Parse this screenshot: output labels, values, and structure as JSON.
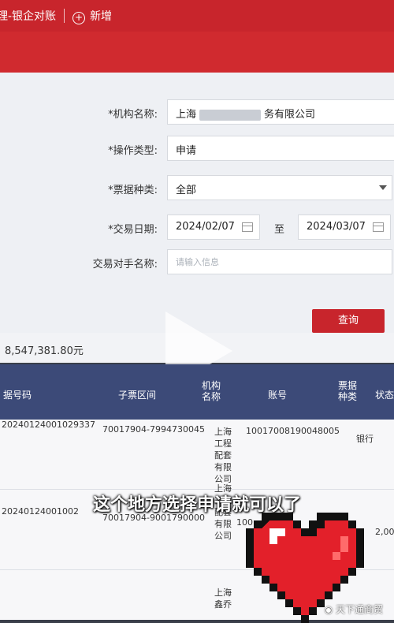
{
  "tabs": [
    {
      "label": "理-银企对账"
    },
    {
      "label": "新增"
    }
  ],
  "form": {
    "org": {
      "label": "*机构名称:",
      "prefix": "上海",
      "suffix": "务有限公司"
    },
    "op_type": {
      "label": "*操作类型:",
      "value": "申请"
    },
    "bill_type": {
      "label": "*票据种类:",
      "value": "全部"
    },
    "date": {
      "label": "*交易日期:",
      "from": "2024/02/07",
      "to_label": "至",
      "to": "2024/03/07"
    },
    "counterparty": {
      "label": "交易对手名称:",
      "placeholder": "请输入信息"
    },
    "query_label": "查询"
  },
  "summary": "8,547,381.80元",
  "table": {
    "headers": [
      "据号码",
      "子票区间",
      "机构名称",
      "账号",
      "票据种类",
      "状态"
    ],
    "rows": [
      {
        "bill_no": "20240124001029337",
        "range": "70017904-7994730045",
        "org": "上海工程配套有限公司",
        "account": "10017008190048005",
        "type": "银行",
        "amount": ""
      },
      {
        "bill_no": "20240124001002",
        "range": "70017904-9001790000",
        "org": "上海工程配套有限公司",
        "account": "100",
        "type": "",
        "amount": "2,00"
      },
      {
        "bill_no": "",
        "range": "",
        "org": "上海鑫乔",
        "account": "",
        "type": "",
        "amount": ""
      }
    ]
  },
  "caption": "这个地方选择申请就可以了",
  "watermark": "天下通商贸",
  "colors": {
    "brand_red": "#c8252c",
    "table_header": "#3c4a78"
  }
}
